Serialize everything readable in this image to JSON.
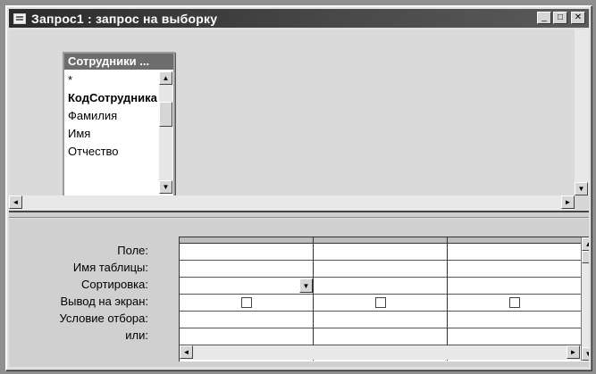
{
  "window": {
    "title": "Запрос1 : запрос на выборку",
    "buttons": {
      "minimize": "_",
      "maximize": "□",
      "close": "✕"
    }
  },
  "field_list": {
    "title": "Сотрудники ...",
    "items": [
      {
        "label": "*",
        "bold": false
      },
      {
        "label": "КодСотрудника",
        "bold": true
      },
      {
        "label": "Фамилия",
        "bold": false
      },
      {
        "label": "Имя",
        "bold": false
      },
      {
        "label": "Отчество",
        "bold": false
      }
    ]
  },
  "grid": {
    "row_labels": [
      "Поле:",
      "Имя таблицы:",
      "Сортировка:",
      "Вывод на экран:",
      "Условие отбора:",
      "или:"
    ],
    "columns": 3,
    "show_checkboxes": [
      false,
      false,
      false
    ]
  },
  "icons": {
    "arrow_up": "▲",
    "arrow_down": "▼",
    "arrow_left": "◄",
    "arrow_right": "►",
    "dropdown": "▼"
  }
}
